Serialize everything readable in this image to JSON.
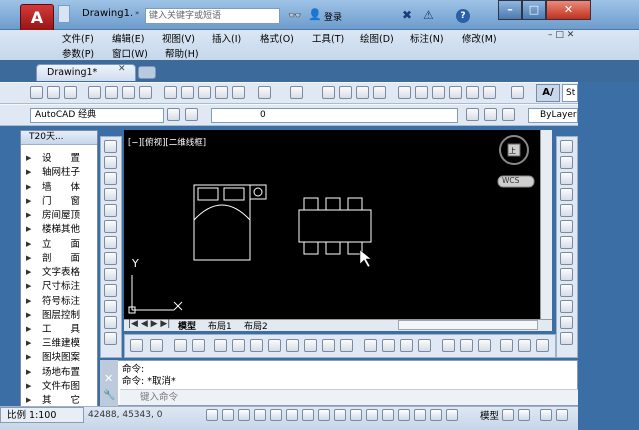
{
  "app": {
    "logo_letter": "A",
    "doc_title": "Drawing1.d...",
    "search_placeholder": "键入关键字或短语",
    "login_label": "登录",
    "help_label": "?"
  },
  "window_controls": {
    "minimize": "–",
    "maximize": "□",
    "close": "✕"
  },
  "menu": {
    "row1": [
      "文件(F)",
      "编辑(E)",
      "视图(V)",
      "插入(I)",
      "格式(O)",
      "工具(T)",
      "绘图(D)",
      "标注(N)",
      "修改(M)"
    ],
    "row2": [
      "参数(P)",
      "窗口(W)",
      "帮助(H)"
    ],
    "mdi_controls": "– □ ✕"
  },
  "tabs": {
    "active": "Drawing1*",
    "close": "✕"
  },
  "toolbar": {
    "workspace": "AutoCAD 经典",
    "layer_value": "0",
    "linetype": "ByLayer",
    "text_style_icon": "A/",
    "text_style_value": "St"
  },
  "palette": {
    "title": "T20天...",
    "items": [
      "设　　置",
      "轴网柱子",
      "墙　　体",
      "门　　窗",
      "房间屋顶",
      "楼梯其他",
      "立　　面",
      "剖　　面",
      "文字表格",
      "尺寸标注",
      "符号标注",
      "图层控制",
      "工　　具",
      "三维建模",
      "图块图案",
      "场地布置",
      "文件布图",
      "其　　它"
    ]
  },
  "viewport": {
    "label": "[−][俯视][二维线框]",
    "wcs": "WCS",
    "axis_y": "Y",
    "compass": "上"
  },
  "layout_tabs": [
    "模型",
    "布局1",
    "布局2"
  ],
  "command": {
    "line1": "命令:",
    "line2": "命令: *取消*",
    "input_placeholder": "键入命令"
  },
  "status": {
    "scale": "比例 1:100",
    "coords": "42488, 45343, 0",
    "model": "模型"
  },
  "colors": {
    "titlebar": "#7aa6d6",
    "canvas": "#000000",
    "accent_red": "#c1311d"
  }
}
